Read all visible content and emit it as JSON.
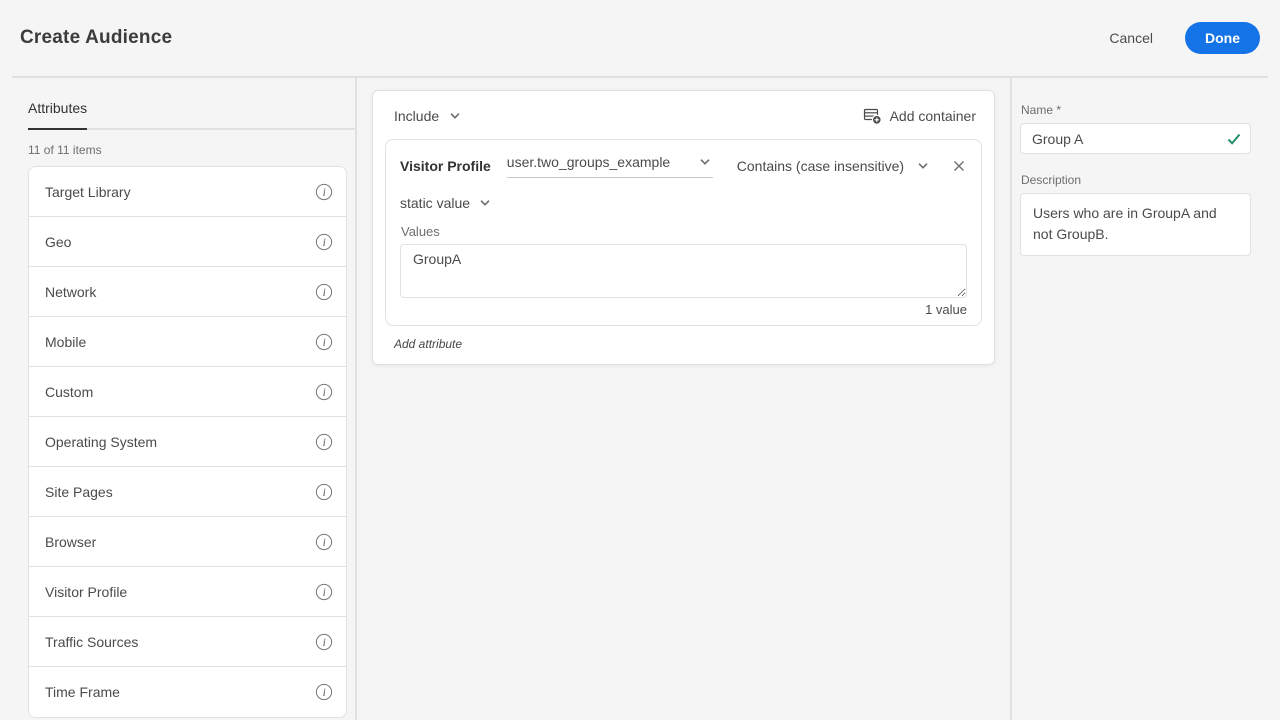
{
  "header": {
    "title": "Create Audience",
    "cancel_label": "Cancel",
    "done_label": "Done"
  },
  "sidebar": {
    "tab_label": "Attributes",
    "items_count": "11 of 11 items",
    "items": [
      "Target Library",
      "Geo",
      "Network",
      "Mobile",
      "Custom",
      "Operating System",
      "Site Pages",
      "Browser",
      "Visitor Profile",
      "Traffic Sources",
      "Time Frame"
    ]
  },
  "builder": {
    "combiner_label": "Include",
    "add_container_label": "Add container",
    "attribute_card": {
      "attribute_type": "Visitor Profile",
      "attribute_value": "user.two_groups_example",
      "operator": "Contains (case insensitive)",
      "value_source": "static value",
      "values_label": "Values",
      "values_text": "GroupA",
      "values_count": "1 value"
    },
    "add_attribute_label": "Add attribute"
  },
  "details": {
    "name_label": "Name *",
    "name_value": "Group A",
    "description_label": "Description",
    "description_value": "Users who are in GroupA and not GroupB."
  },
  "icons": {
    "chevron": "chevron-down",
    "info": "info-circle",
    "add_container": "container-add-plus",
    "close": "close-x",
    "check": "checkmark",
    "resize": "resize-handle"
  },
  "colors": {
    "accent_blue": "#1473e6",
    "success_green": "#268e6c",
    "background": "#f5f5f5",
    "border": "#e1e1e1"
  }
}
